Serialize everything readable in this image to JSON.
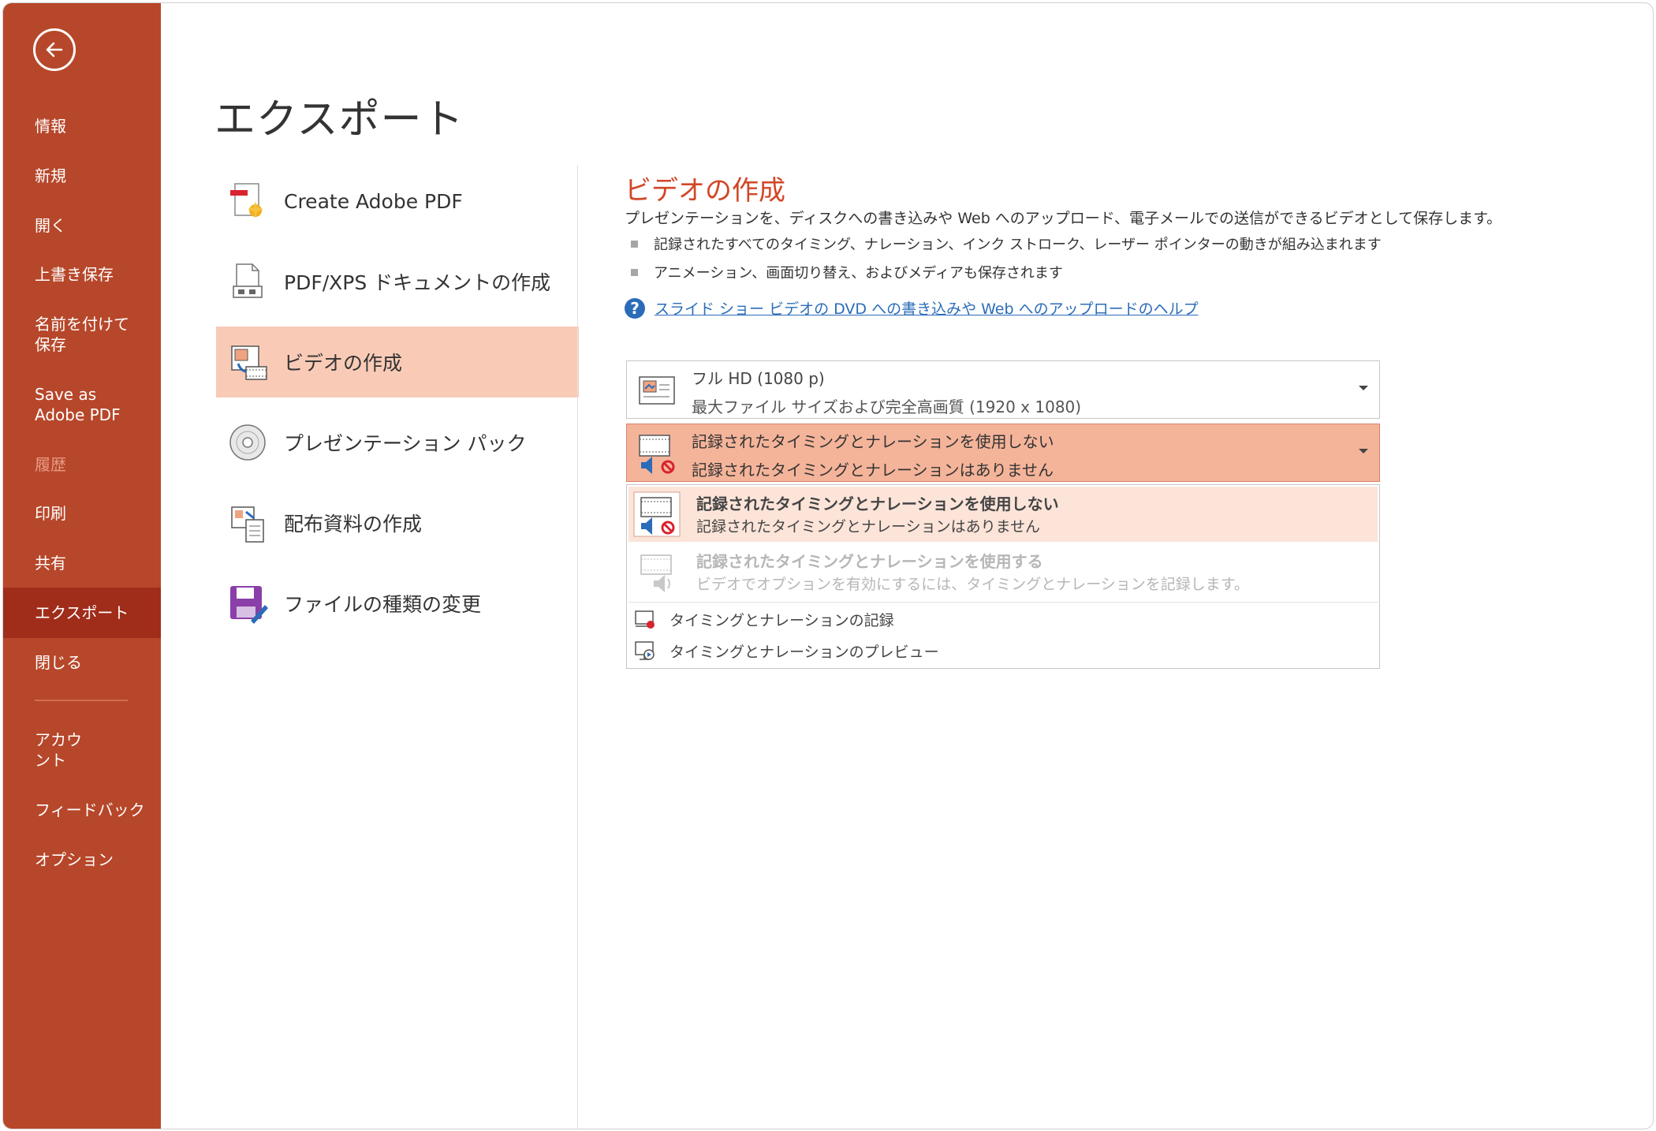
{
  "sidebar": {
    "items": [
      {
        "label": "情報",
        "state": "normal"
      },
      {
        "label": "新規",
        "state": "normal"
      },
      {
        "label": "開く",
        "state": "normal"
      },
      {
        "label": "上書き保存",
        "state": "normal"
      },
      {
        "label": "名前を付けて保存",
        "state": "normal"
      },
      {
        "label": "Save as Adobe PDF",
        "state": "normal"
      },
      {
        "label": "履歴",
        "state": "disabled"
      },
      {
        "label": "印刷",
        "state": "normal"
      },
      {
        "label": "共有",
        "state": "normal"
      },
      {
        "label": "エクスポート",
        "state": "active"
      },
      {
        "label": "閉じる",
        "state": "normal"
      },
      {
        "label": "アカウント",
        "state": "normal"
      },
      {
        "label": "フィードバック",
        "state": "normal"
      },
      {
        "label": "オプション",
        "state": "normal"
      }
    ]
  },
  "page": {
    "title": "エクスポート"
  },
  "export_options": [
    {
      "label": "Create Adobe PDF",
      "icon": "adobe-pdf-icon"
    },
    {
      "label": "PDF/XPS ドキュメントの作成",
      "icon": "pdf-xps-icon"
    },
    {
      "label": "ビデオの作成",
      "icon": "video-icon",
      "selected": true
    },
    {
      "label": "プレゼンテーション パック",
      "icon": "cd-icon"
    },
    {
      "label": "配布資料の作成",
      "icon": "handout-icon"
    },
    {
      "label": "ファイルの種類の変更",
      "icon": "save-as-icon"
    }
  ],
  "video": {
    "title": "ビデオの作成",
    "description": "プレゼンテーションを、ディスクへの書き込みや Web へのアップロード、電子メールでの送信ができるビデオとして保存します。",
    "bullets": [
      "記録されたすべてのタイミング、ナレーション、インク ストローク、レーザー ポインターの動きが組み込まれます",
      "アニメーション、画面切り替え、およびメディアも保存されます"
    ],
    "help_link": "スライド ショー ビデオの DVD への書き込みや Web へのアップロードのヘルプ"
  },
  "quality_dropdown": {
    "line1": "フル HD (1080 p)",
    "line2": "最大ファイル サイズおよび完全高画質 (1920 x 1080)"
  },
  "timing_dropdown": {
    "line1": "記録されたタイミングとナレーションを使用しない",
    "line2": "記録されたタイミングとナレーションはありません"
  },
  "timing_menu": {
    "options": [
      {
        "title": "記録されたタイミングとナレーションを使用しない",
        "subtitle": "記録されたタイミングとナレーションはありません",
        "enabled": true,
        "highlighted": true
      },
      {
        "title": "記録されたタイミングとナレーションを使用する",
        "subtitle": "ビデオでオプションを有効にするには、タイミングとナレーションを記録します。",
        "enabled": false
      }
    ],
    "actions": [
      {
        "label": "タイミングとナレーションの記録",
        "icon": "record-icon"
      },
      {
        "label": "タイミングとナレーションのプレビュー",
        "icon": "preview-icon"
      }
    ]
  },
  "colors": {
    "sidebar_bg": "#b7472a",
    "sidebar_active": "#a02d1a",
    "accent_title": "#d24726",
    "selected_item": "#f9cbb7",
    "link": "#2b6cb8"
  }
}
